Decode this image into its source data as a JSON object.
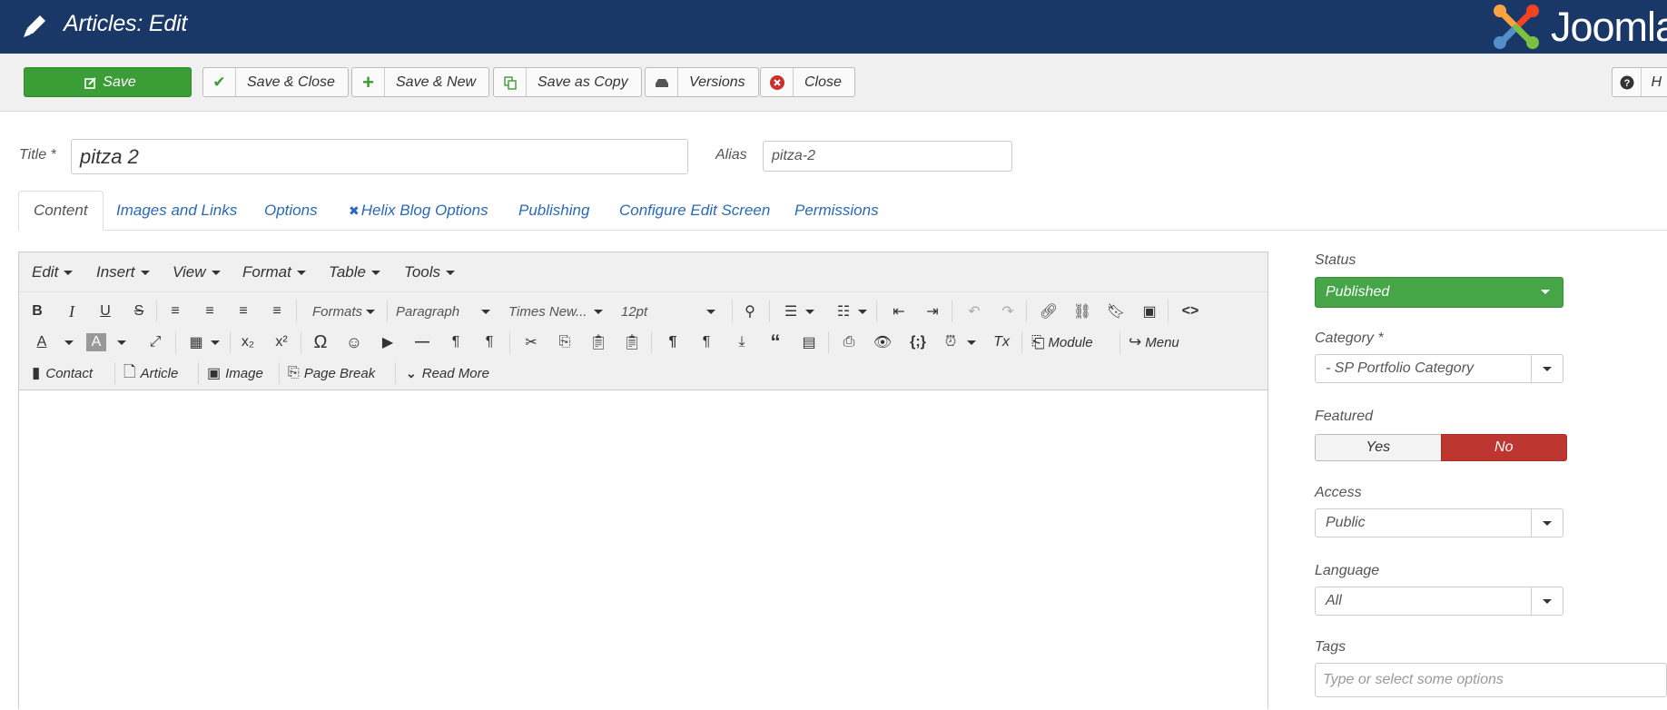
{
  "header": {
    "title": "Articles: Edit",
    "logo_text": "Joomla"
  },
  "toolbar": {
    "save": "Save",
    "save_close": "Save & Close",
    "save_new": "Save & New",
    "save_copy": "Save as Copy",
    "versions": "Versions",
    "close": "Close",
    "help": "H"
  },
  "form": {
    "title_label": "Title *",
    "title_value": "pitza 2",
    "alias_label": "Alias",
    "alias_value": "pitza-2"
  },
  "tabs": [
    "Content",
    "Images and Links",
    "Options",
    "Helix Blog Options",
    "Publishing",
    "Configure Edit Screen",
    "Permissions"
  ],
  "editor": {
    "menus": [
      "Edit",
      "Insert",
      "View",
      "Format",
      "Table",
      "Tools"
    ],
    "formats": "Formats",
    "paragraph": "Paragraph",
    "font": "Times New...",
    "size": "12pt",
    "module": "Module",
    "menu": "Menu",
    "contact": "Contact",
    "article": "Article",
    "image": "Image",
    "page_break": "Page Break",
    "read_more": "Read More"
  },
  "sidebar": {
    "status_label": "Status",
    "status_value": "Published",
    "category_label": "Category *",
    "category_value": "- SP Portfolio Category",
    "featured_label": "Featured",
    "featured_yes": "Yes",
    "featured_no": "No",
    "access_label": "Access",
    "access_value": "Public",
    "language_label": "Language",
    "language_value": "All",
    "tags_label": "Tags",
    "tags_placeholder": "Type or select some options"
  },
  "colors": {
    "header": "#1a3867",
    "save": "#3b9d35",
    "published": "#46a546",
    "no": "#bd362f",
    "link": "#2a69b8"
  }
}
